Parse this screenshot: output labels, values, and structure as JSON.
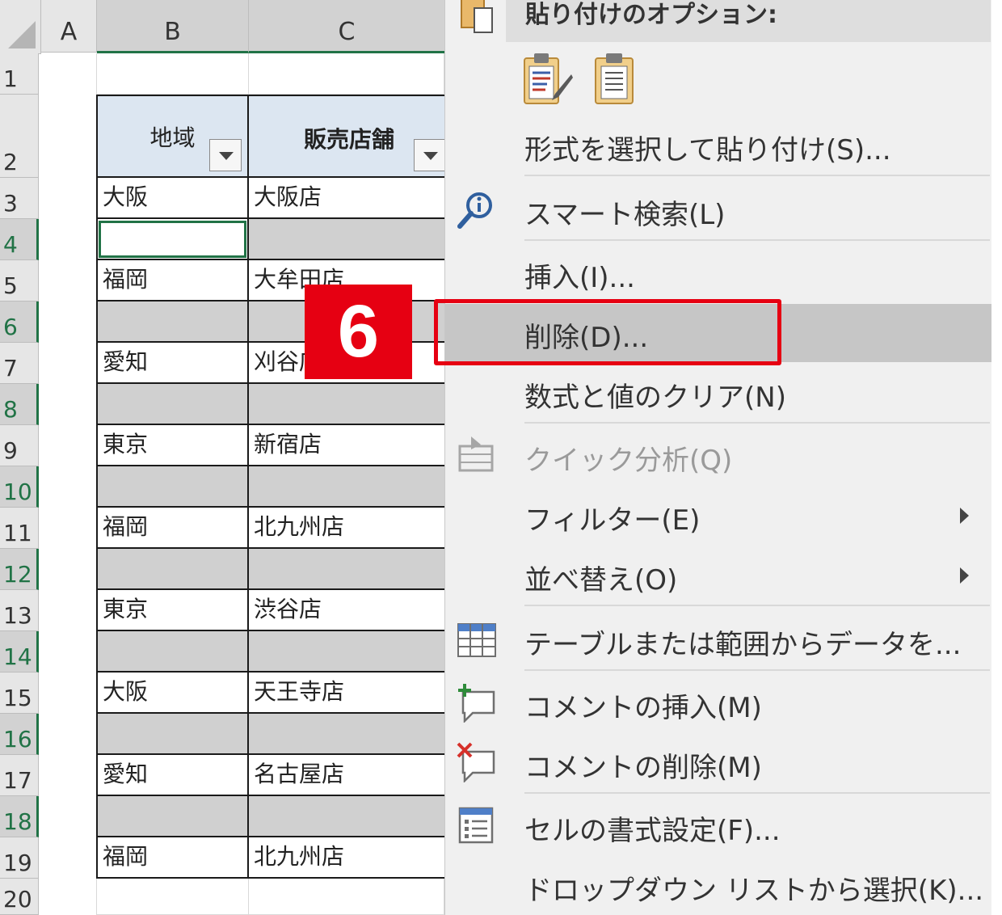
{
  "sheet": {
    "columns": [
      "A",
      "B",
      "C"
    ],
    "rows": [
      "1",
      "2",
      "3",
      "4",
      "5",
      "6",
      "7",
      "8",
      "9",
      "10",
      "11",
      "12",
      "13",
      "14",
      "15",
      "16",
      "17",
      "18",
      "19",
      "20"
    ],
    "header": {
      "region": "地域",
      "store": "販売店舗"
    },
    "data": [
      {
        "row": 3,
        "region": "大阪",
        "store": "大阪店",
        "hidden_sel": false
      },
      {
        "row": 4,
        "region": "",
        "store": "",
        "blank": true
      },
      {
        "row": 5,
        "region": "福岡",
        "store": "大牟田店"
      },
      {
        "row": 6,
        "region": "",
        "store": "",
        "blank": true
      },
      {
        "row": 7,
        "region": "愛知",
        "store": "刈谷店"
      },
      {
        "row": 8,
        "region": "",
        "store": "",
        "blank": true
      },
      {
        "row": 9,
        "region": "東京",
        "store": "新宿店"
      },
      {
        "row": 10,
        "region": "",
        "store": "",
        "blank": true
      },
      {
        "row": 11,
        "region": "福岡",
        "store": "北九州店"
      },
      {
        "row": 12,
        "region": "",
        "store": "",
        "blank": true
      },
      {
        "row": 13,
        "region": "東京",
        "store": "渋谷店"
      },
      {
        "row": 14,
        "region": "",
        "store": "",
        "blank": true
      },
      {
        "row": 15,
        "region": "大阪",
        "store": "天王寺店"
      },
      {
        "row": 16,
        "region": "",
        "store": "",
        "blank": true
      },
      {
        "row": 17,
        "region": "愛知",
        "store": "名古屋店"
      },
      {
        "row": 18,
        "region": "",
        "store": "",
        "blank": true
      },
      {
        "row": 19,
        "region": "福岡",
        "store": "北九州店"
      }
    ]
  },
  "menu": {
    "paste_options_label": "貼り付けのオプション:",
    "items": [
      {
        "label": "形式を選択して貼り付け(S)..."
      },
      {
        "label": "スマート検索(L)",
        "icon": "smart-lookup-icon"
      },
      {
        "label": "挿入(I)..."
      },
      {
        "label": "削除(D)...",
        "highlighted": true
      },
      {
        "label": "数式と値のクリア(N)"
      },
      {
        "label": "クイック分析(Q)",
        "disabled": true,
        "icon": "quick-analysis-icon"
      },
      {
        "label": "フィルター(E)",
        "submenu": true
      },
      {
        "label": "並べ替え(O)",
        "submenu": true
      },
      {
        "label": "テーブルまたは範囲からデータを...",
        "icon": "table-icon"
      },
      {
        "label": "コメントの挿入(M)",
        "icon": "insert-comment-icon"
      },
      {
        "label": "コメントの削除(M)",
        "icon": "delete-comment-icon"
      },
      {
        "label": "セルの書式設定(F)...",
        "icon": "format-cells-icon"
      },
      {
        "label": "ドロップダウン リストから選択(K)..."
      }
    ]
  },
  "annotation": {
    "step_number": "6"
  },
  "colors": {
    "accent_green": "#217346",
    "highlight_red": "#e60012",
    "header_blue": "#dce6f1"
  }
}
